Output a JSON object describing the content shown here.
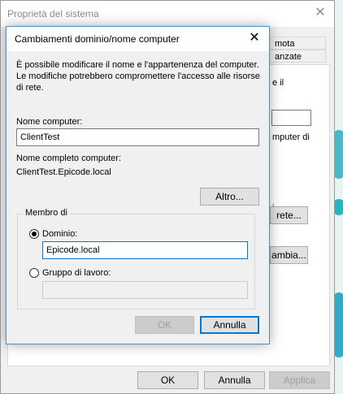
{
  "background_window": {
    "title": "Proprietà del sistema",
    "tab_fragment_1": "mota",
    "tab_fragment_2": "anzate",
    "text_fragment_1": "e il",
    "text_fragment_2": "mputer di",
    "text_fragment_3": "i",
    "button_rete": "rete...",
    "button_cambia": "ambia...",
    "ok_label": "OK",
    "cancel_label": "Annulla",
    "apply_label": "Applica"
  },
  "dialog": {
    "title": "Cambiamenti dominio/nome computer",
    "description": "È possibile modificare il nome e l'appartenenza del computer. Le modifiche potrebbero compromettere l'accesso alle risorse di rete.",
    "computer_name_label": "Nome computer:",
    "computer_name_value": "ClientTest",
    "full_name_label": "Nome completo computer:",
    "full_name_value": "ClientTest.Epicode.local",
    "more_button": "Altro...",
    "member_of_label": "Membro di",
    "domain_label": "Dominio:",
    "domain_value": "Epicode.local",
    "workgroup_label": "Gruppo di lavoro:",
    "workgroup_value": "",
    "ok_label": "OK",
    "cancel_label": "Annulla"
  },
  "colors": {
    "accent": "#0078d7",
    "desktop": "#2b7a8a"
  }
}
